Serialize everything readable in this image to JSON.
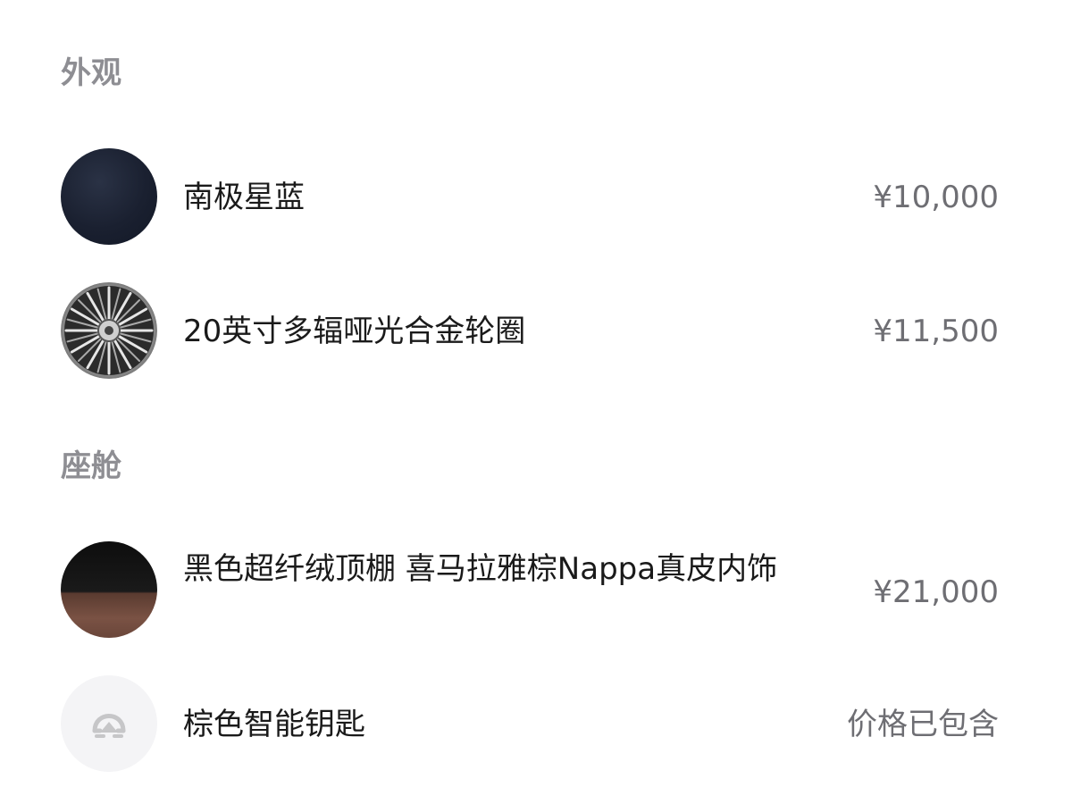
{
  "sections": [
    {
      "title": "外观",
      "items": [
        {
          "name": "南极星蓝",
          "price": "¥10,000",
          "thumbnail_icon": "paint-swatch-icon",
          "swatch_color": "#1a2030"
        },
        {
          "name": "20英寸多辐哑光合金轮圈",
          "price": "¥11,500",
          "thumbnail_icon": "alloy-wheel-icon"
        }
      ]
    },
    {
      "title": "座舱",
      "items": [
        {
          "name": "黑色超纤绒顶棚 喜马拉雅棕Nappa真皮内饰",
          "price": "¥21,000",
          "thumbnail_icon": "interior-swatch-icon",
          "swatch_colors": [
            "#111111",
            "#6f4a3d"
          ]
        },
        {
          "name": "棕色智能钥匙",
          "price": "价格已包含",
          "thumbnail_icon": "brand-logo-icon"
        }
      ]
    }
  ],
  "colors": {
    "section_title": "#8e8e93",
    "item_text": "#1a1a1a",
    "price_text": "#6e6e73",
    "background": "#ffffff"
  }
}
